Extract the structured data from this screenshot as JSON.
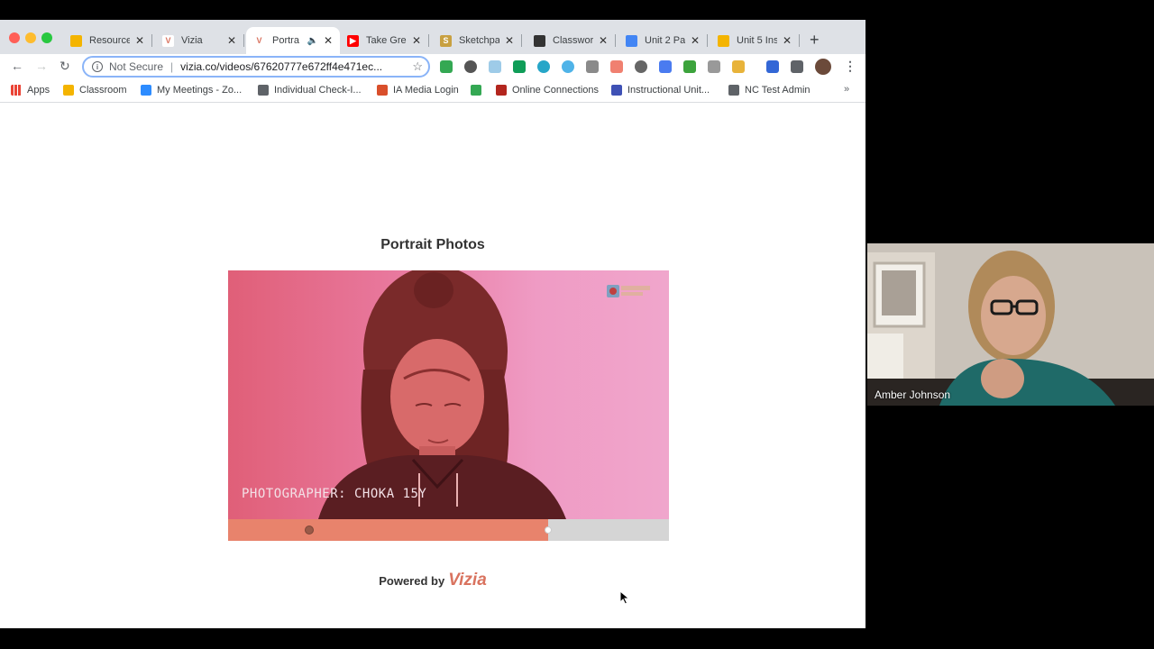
{
  "browser": {
    "tabs": [
      {
        "label": "Resources",
        "favicon_color": "#f4b400",
        "favicon_glyph": "",
        "active": false
      },
      {
        "label": "Vizia",
        "favicon_color": "#ffffff",
        "favicon_glyph": "V",
        "active": false
      },
      {
        "label": "Portra",
        "favicon_color": "#ffffff",
        "favicon_glyph": "V",
        "active": true
      },
      {
        "label": "Take Grea",
        "favicon_color": "#ff0000",
        "favicon_glyph": "▶",
        "active": false
      },
      {
        "label": "Sketchpa",
        "favicon_color": "#c8a040",
        "favicon_glyph": "S",
        "active": false
      },
      {
        "label": "Classwork",
        "favicon_color": "#333333",
        "favicon_glyph": "",
        "active": false
      },
      {
        "label": "Unit 2 Pa",
        "favicon_color": "#4285f4",
        "favicon_glyph": "",
        "active": false
      },
      {
        "label": "Unit 5 Ins",
        "favicon_color": "#f4b400",
        "favicon_glyph": "",
        "active": false
      }
    ],
    "address": {
      "security_label": "Not Secure",
      "url": "vizia.co/videos/67620777e672ff4e471ec..."
    },
    "bookmarks": [
      {
        "label": "Apps",
        "icon_color": "#ea4335"
      },
      {
        "label": "Classroom",
        "icon_color": "#f4b400"
      },
      {
        "label": "My Meetings - Zo...",
        "icon_color": "#2d8cff"
      },
      {
        "label": "Individual Check-I...",
        "icon_color": "#5f6368"
      },
      {
        "label": "IA Media Login",
        "icon_color": "#d94f2b"
      },
      {
        "label": "",
        "icon_color": "#34a853"
      },
      {
        "label": "Online Connections",
        "icon_color": "#b3261e"
      },
      {
        "label": "Instructional Unit...",
        "icon_color": "#3f51b5"
      },
      {
        "label": "NC Test Admin",
        "icon_color": "#5f6368"
      }
    ],
    "bookmarks_overflow": "»"
  },
  "page": {
    "video_title": "Portrait Photos",
    "caption": "PHOTOGRAPHER: CHOKA 15Y",
    "watermark": "SHARP SHOTS",
    "progress_fraction": 0.725,
    "marker_fraction": 0.185,
    "powered_by": "Powered by",
    "brand": "Vizia"
  },
  "webcam": {
    "participant_name": "Amber Johnson"
  },
  "colors": {
    "accent": "#d9735f",
    "progress_fill": "#e8836c",
    "omnibox_focus": "#8ab4f8"
  }
}
